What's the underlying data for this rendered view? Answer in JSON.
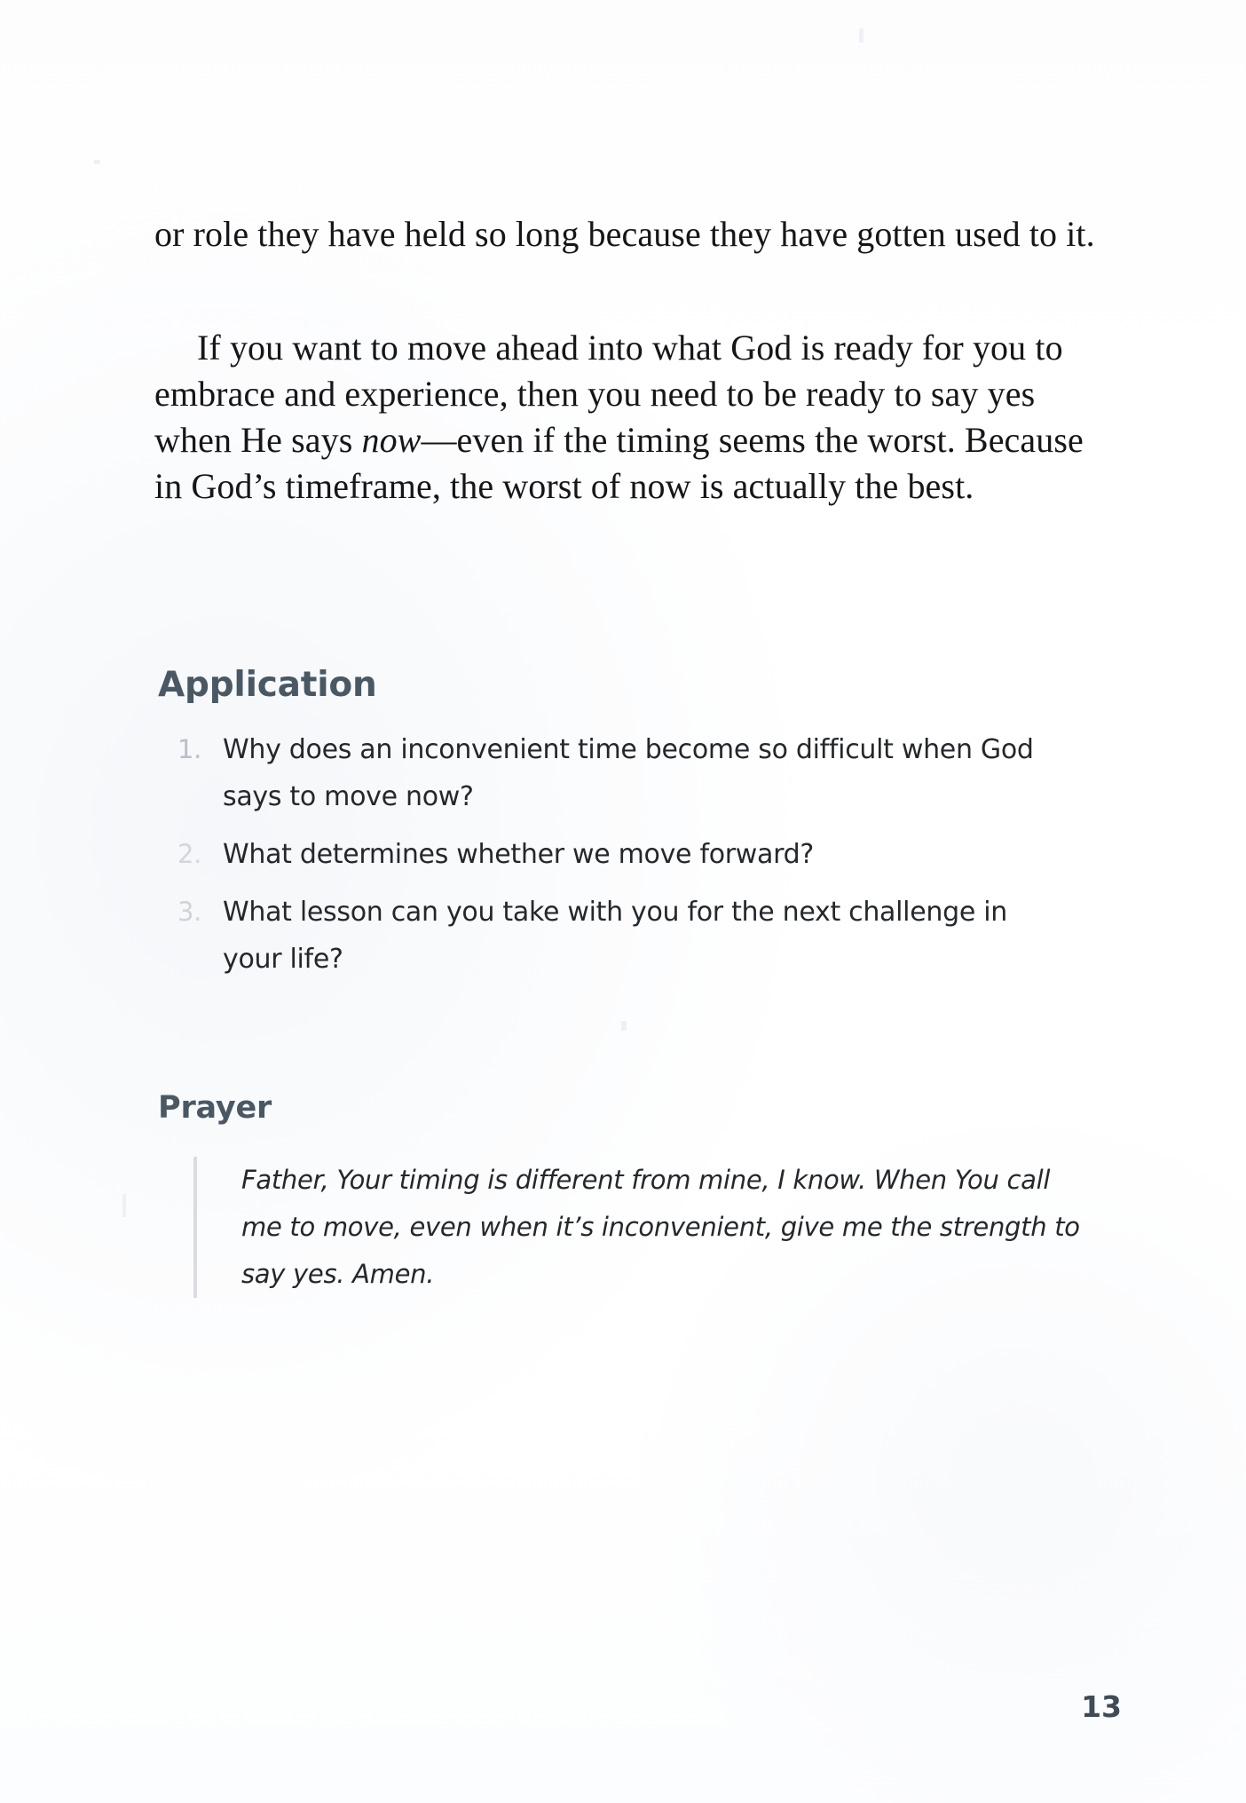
{
  "page": {
    "number": "13",
    "background_color": "#ffffff",
    "body_text_color": "#16161a",
    "heading_color": "#4a5864",
    "accent_rule_color": "#d9dde1",
    "list_number_color": "#c9ced4"
  },
  "body": {
    "paragraph_1": "or role they have held so long because they have gotten used to it.",
    "paragraph_2_before_italic": "If you want to move ahead into what God is ready for you to embrace and experience, then you need to be ready to say yes when He says ",
    "paragraph_2_italic": "now",
    "paragraph_2_after_italic": "—even if the timing seems the worst. Because in God’s timeframe, the worst of now is actually the best."
  },
  "application": {
    "heading": "Application",
    "items": [
      {
        "number": "1.",
        "text": "Why does an inconvenient time become so difficult when God says to move now?"
      },
      {
        "number": "2.",
        "text": "What determines whether we move forward?"
      },
      {
        "number": "3.",
        "text": "What lesson can you take with you for the next challenge in your life?"
      }
    ]
  },
  "prayer": {
    "heading": "Prayer",
    "text": "Father, Your timing is different from mine, I know. When You call me to move, even when it’s inconvenient, give me the strength to say yes. Amen."
  }
}
